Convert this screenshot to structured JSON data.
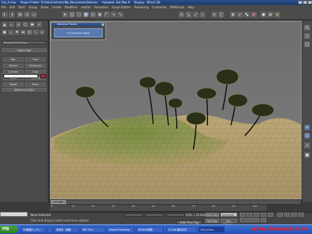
{
  "window": {
    "title": "Cat_A.max",
    "project": "Project Folder: D:\\Administrator\\My Documents\\3dsmax",
    "app": "Autodesk 3ds Max 9",
    "display": "Display : Direct 3D"
  },
  "menu": [
    "File",
    "Edit",
    "Tools",
    "Group",
    "Views",
    "Create",
    "Modifiers",
    "reactor",
    "Animation",
    "Graph Editors",
    "Rendering",
    "Customize",
    "MAXScript",
    "Help"
  ],
  "toolbar": {
    "selection_filter": "All",
    "view_label": "View"
  },
  "command_panel": {
    "dropdown": "Standard Primitives",
    "object_type_header": "Object Type",
    "objects": [
      "Box",
      "Cone",
      "Sphere",
      "GeoSphere",
      "Cylinder",
      "Tube",
      "Torus",
      "Pyramid",
      "Teapot",
      "Plane"
    ],
    "name_color_header": "Name and Color"
  },
  "viewport": {
    "label": "Perspective"
  },
  "floating_dialog": {
    "title": "Selection Floater",
    "button": "Exit Isolation Mode"
  },
  "time_slider": {
    "frame": "0 / 100",
    "ticks": [
      "0",
      "10",
      "20",
      "30",
      "40",
      "50",
      "60",
      "70",
      "80",
      "90",
      "100"
    ]
  },
  "status": {
    "selection": "None Selected",
    "prompt": "Click and drag to select and move objects",
    "grid": "Grid = 10.0mm",
    "add_time_tag": "Add Time Tag",
    "auto_key": "Auto Key",
    "selected": "Selected",
    "set_key": "Set Key",
    "key_filters": "Key Filters..."
  },
  "taskbar": {
    "start": "开始",
    "tasks": [
      "3D建模(F)_UG...",
      "",
      "未命名 - 画图",
      "PAX Plus",
      "Adobe Photoshop",
      "3DsMax教程",
      "AI Soft 翻译文件",
      "Cat_A.max -"
    ]
  },
  "watermark": "www.3dmax8.com",
  "colors": {
    "accent": "#5778b0",
    "title": "#22437c",
    "watermark": "#e02020"
  }
}
